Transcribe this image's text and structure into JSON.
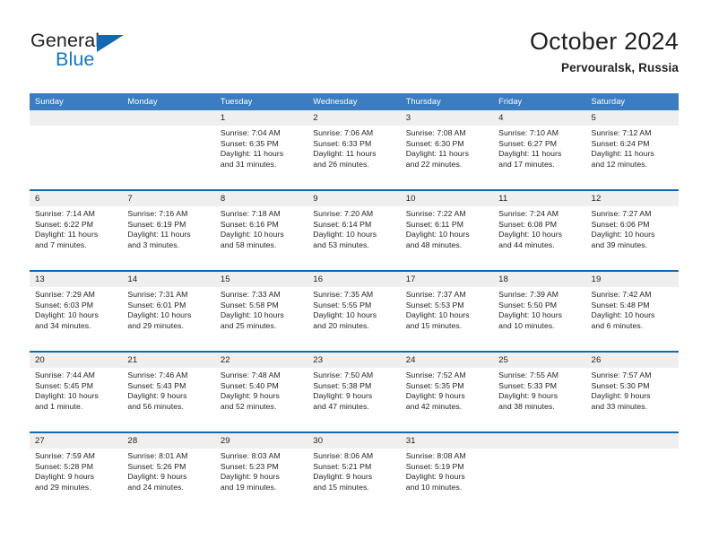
{
  "brand": {
    "line1": "General",
    "line2": "Blue",
    "triangle_icon": "triangle-icon",
    "accent_color": "#1268b3"
  },
  "header": {
    "title": "October 2024",
    "subtitle": "Pervouralsk, Russia"
  },
  "calendar": {
    "header_bg": "#3b7dc0",
    "row_divider_color": "#1268b3",
    "date_band_bg": "#efefef",
    "weekday_names": [
      "Sunday",
      "Monday",
      "Tuesday",
      "Wednesday",
      "Thursday",
      "Friday",
      "Saturday"
    ],
    "weeks": [
      [
        {
          "day": "",
          "lines": [],
          "state": "empty"
        },
        {
          "day": "",
          "lines": [],
          "state": "empty"
        },
        {
          "day": "1",
          "lines": [
            "Sunrise: 7:04 AM",
            "Sunset: 6:35 PM",
            "Daylight: 11 hours",
            "and 31 minutes."
          ],
          "state": "filled"
        },
        {
          "day": "2",
          "lines": [
            "Sunrise: 7:06 AM",
            "Sunset: 6:33 PM",
            "Daylight: 11 hours",
            "and 26 minutes."
          ],
          "state": "filled"
        },
        {
          "day": "3",
          "lines": [
            "Sunrise: 7:08 AM",
            "Sunset: 6:30 PM",
            "Daylight: 11 hours",
            "and 22 minutes."
          ],
          "state": "filled"
        },
        {
          "day": "4",
          "lines": [
            "Sunrise: 7:10 AM",
            "Sunset: 6:27 PM",
            "Daylight: 11 hours",
            "and 17 minutes."
          ],
          "state": "filled"
        },
        {
          "day": "5",
          "lines": [
            "Sunrise: 7:12 AM",
            "Sunset: 6:24 PM",
            "Daylight: 11 hours",
            "and 12 minutes."
          ],
          "state": "filled"
        }
      ],
      [
        {
          "day": "6",
          "lines": [
            "Sunrise: 7:14 AM",
            "Sunset: 6:22 PM",
            "Daylight: 11 hours",
            "and 7 minutes."
          ],
          "state": "filled"
        },
        {
          "day": "7",
          "lines": [
            "Sunrise: 7:16 AM",
            "Sunset: 6:19 PM",
            "Daylight: 11 hours",
            "and 3 minutes."
          ],
          "state": "filled"
        },
        {
          "day": "8",
          "lines": [
            "Sunrise: 7:18 AM",
            "Sunset: 6:16 PM",
            "Daylight: 10 hours",
            "and 58 minutes."
          ],
          "state": "filled"
        },
        {
          "day": "9",
          "lines": [
            "Sunrise: 7:20 AM",
            "Sunset: 6:14 PM",
            "Daylight: 10 hours",
            "and 53 minutes."
          ],
          "state": "filled"
        },
        {
          "day": "10",
          "lines": [
            "Sunrise: 7:22 AM",
            "Sunset: 6:11 PM",
            "Daylight: 10 hours",
            "and 48 minutes."
          ],
          "state": "filled"
        },
        {
          "day": "11",
          "lines": [
            "Sunrise: 7:24 AM",
            "Sunset: 6:08 PM",
            "Daylight: 10 hours",
            "and 44 minutes."
          ],
          "state": "filled"
        },
        {
          "day": "12",
          "lines": [
            "Sunrise: 7:27 AM",
            "Sunset: 6:06 PM",
            "Daylight: 10 hours",
            "and 39 minutes."
          ],
          "state": "filled"
        }
      ],
      [
        {
          "day": "13",
          "lines": [
            "Sunrise: 7:29 AM",
            "Sunset: 6:03 PM",
            "Daylight: 10 hours",
            "and 34 minutes."
          ],
          "state": "filled"
        },
        {
          "day": "14",
          "lines": [
            "Sunrise: 7:31 AM",
            "Sunset: 6:01 PM",
            "Daylight: 10 hours",
            "and 29 minutes."
          ],
          "state": "filled"
        },
        {
          "day": "15",
          "lines": [
            "Sunrise: 7:33 AM",
            "Sunset: 5:58 PM",
            "Daylight: 10 hours",
            "and 25 minutes."
          ],
          "state": "filled"
        },
        {
          "day": "16",
          "lines": [
            "Sunrise: 7:35 AM",
            "Sunset: 5:55 PM",
            "Daylight: 10 hours",
            "and 20 minutes."
          ],
          "state": "filled"
        },
        {
          "day": "17",
          "lines": [
            "Sunrise: 7:37 AM",
            "Sunset: 5:53 PM",
            "Daylight: 10 hours",
            "and 15 minutes."
          ],
          "state": "filled"
        },
        {
          "day": "18",
          "lines": [
            "Sunrise: 7:39 AM",
            "Sunset: 5:50 PM",
            "Daylight: 10 hours",
            "and 10 minutes."
          ],
          "state": "filled"
        },
        {
          "day": "19",
          "lines": [
            "Sunrise: 7:42 AM",
            "Sunset: 5:48 PM",
            "Daylight: 10 hours",
            "and 6 minutes."
          ],
          "state": "filled"
        }
      ],
      [
        {
          "day": "20",
          "lines": [
            "Sunrise: 7:44 AM",
            "Sunset: 5:45 PM",
            "Daylight: 10 hours",
            "and 1 minute."
          ],
          "state": "filled"
        },
        {
          "day": "21",
          "lines": [
            "Sunrise: 7:46 AM",
            "Sunset: 5:43 PM",
            "Daylight: 9 hours",
            "and 56 minutes."
          ],
          "state": "filled"
        },
        {
          "day": "22",
          "lines": [
            "Sunrise: 7:48 AM",
            "Sunset: 5:40 PM",
            "Daylight: 9 hours",
            "and 52 minutes."
          ],
          "state": "filled"
        },
        {
          "day": "23",
          "lines": [
            "Sunrise: 7:50 AM",
            "Sunset: 5:38 PM",
            "Daylight: 9 hours",
            "and 47 minutes."
          ],
          "state": "filled"
        },
        {
          "day": "24",
          "lines": [
            "Sunrise: 7:52 AM",
            "Sunset: 5:35 PM",
            "Daylight: 9 hours",
            "and 42 minutes."
          ],
          "state": "filled"
        },
        {
          "day": "25",
          "lines": [
            "Sunrise: 7:55 AM",
            "Sunset: 5:33 PM",
            "Daylight: 9 hours",
            "and 38 minutes."
          ],
          "state": "filled"
        },
        {
          "day": "26",
          "lines": [
            "Sunrise: 7:57 AM",
            "Sunset: 5:30 PM",
            "Daylight: 9 hours",
            "and 33 minutes."
          ],
          "state": "filled"
        }
      ],
      [
        {
          "day": "27",
          "lines": [
            "Sunrise: 7:59 AM",
            "Sunset: 5:28 PM",
            "Daylight: 9 hours",
            "and 29 minutes."
          ],
          "state": "filled"
        },
        {
          "day": "28",
          "lines": [
            "Sunrise: 8:01 AM",
            "Sunset: 5:26 PM",
            "Daylight: 9 hours",
            "and 24 minutes."
          ],
          "state": "filled"
        },
        {
          "day": "29",
          "lines": [
            "Sunrise: 8:03 AM",
            "Sunset: 5:23 PM",
            "Daylight: 9 hours",
            "and 19 minutes."
          ],
          "state": "filled"
        },
        {
          "day": "30",
          "lines": [
            "Sunrise: 8:06 AM",
            "Sunset: 5:21 PM",
            "Daylight: 9 hours",
            "and 15 minutes."
          ],
          "state": "filled"
        },
        {
          "day": "31",
          "lines": [
            "Sunrise: 8:08 AM",
            "Sunset: 5:19 PM",
            "Daylight: 9 hours",
            "and 10 minutes."
          ],
          "state": "filled"
        },
        {
          "day": "",
          "lines": [],
          "state": "empty"
        },
        {
          "day": "",
          "lines": [],
          "state": "empty"
        }
      ]
    ]
  }
}
